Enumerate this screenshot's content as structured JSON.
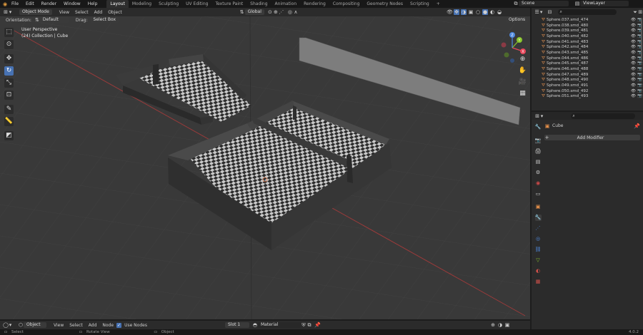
{
  "topbar": {
    "menus": [
      "File",
      "Edit",
      "Render",
      "Window",
      "Help"
    ],
    "workspaces": [
      "Layout",
      "Modeling",
      "Sculpting",
      "UV Editing",
      "Texture Paint",
      "Shading",
      "Animation",
      "Rendering",
      "Compositing",
      "Geometry Nodes",
      "Scripting"
    ],
    "active_workspace": "Layout",
    "add_tab": "+",
    "scene": "Scene",
    "view_layer": "ViewLayer"
  },
  "viewport_header": {
    "mode": "Object Mode",
    "menus": [
      "View",
      "Select",
      "Add",
      "Object"
    ],
    "transform_orientation": "Global"
  },
  "tool_settings": {
    "orientation_label": "Orientation:",
    "orientation_value": "Default",
    "drag_label": "Drag:",
    "drag_value": "Select Box",
    "options": "Options"
  },
  "overlay_text": {
    "perspective": "User Perspective",
    "collection": "(24) Collection | Cube"
  },
  "gizmo": {
    "x": "X",
    "y": "Y",
    "z": "Z"
  },
  "outliner": {
    "items": [
      "Sphere.037.smd_474",
      "Sphere.038.smd_480",
      "Sphere.039.smd_481",
      "Sphere.040.smd_482",
      "Sphere.041.smd_483",
      "Sphere.042.smd_484",
      "Sphere.043.smd_485",
      "Sphere.044.smd_486",
      "Sphere.045.smd_487",
      "Sphere.046.smd_488",
      "Sphere.047.smd_489",
      "Sphere.048.smd_490",
      "Sphere.049.smd_491",
      "Sphere.050.smd_492",
      "Sphere.051.smd_493"
    ]
  },
  "properties": {
    "object_name": "Cube",
    "add_modifier": "Add Modifier"
  },
  "node_header": {
    "editor_type": "Object",
    "menus": [
      "View",
      "Select",
      "Add",
      "Node"
    ],
    "use_nodes": "Use Nodes",
    "slot": "Slot 1",
    "material": "Material"
  },
  "status": {
    "select": "Select",
    "rotate": "Rotate View",
    "object": "Object",
    "version": "4.0.2"
  },
  "colors": {
    "accent": "#4772b3",
    "x_axis": "#e8475b",
    "y_axis": "#8ac72c",
    "z_axis": "#4f8ae0"
  }
}
